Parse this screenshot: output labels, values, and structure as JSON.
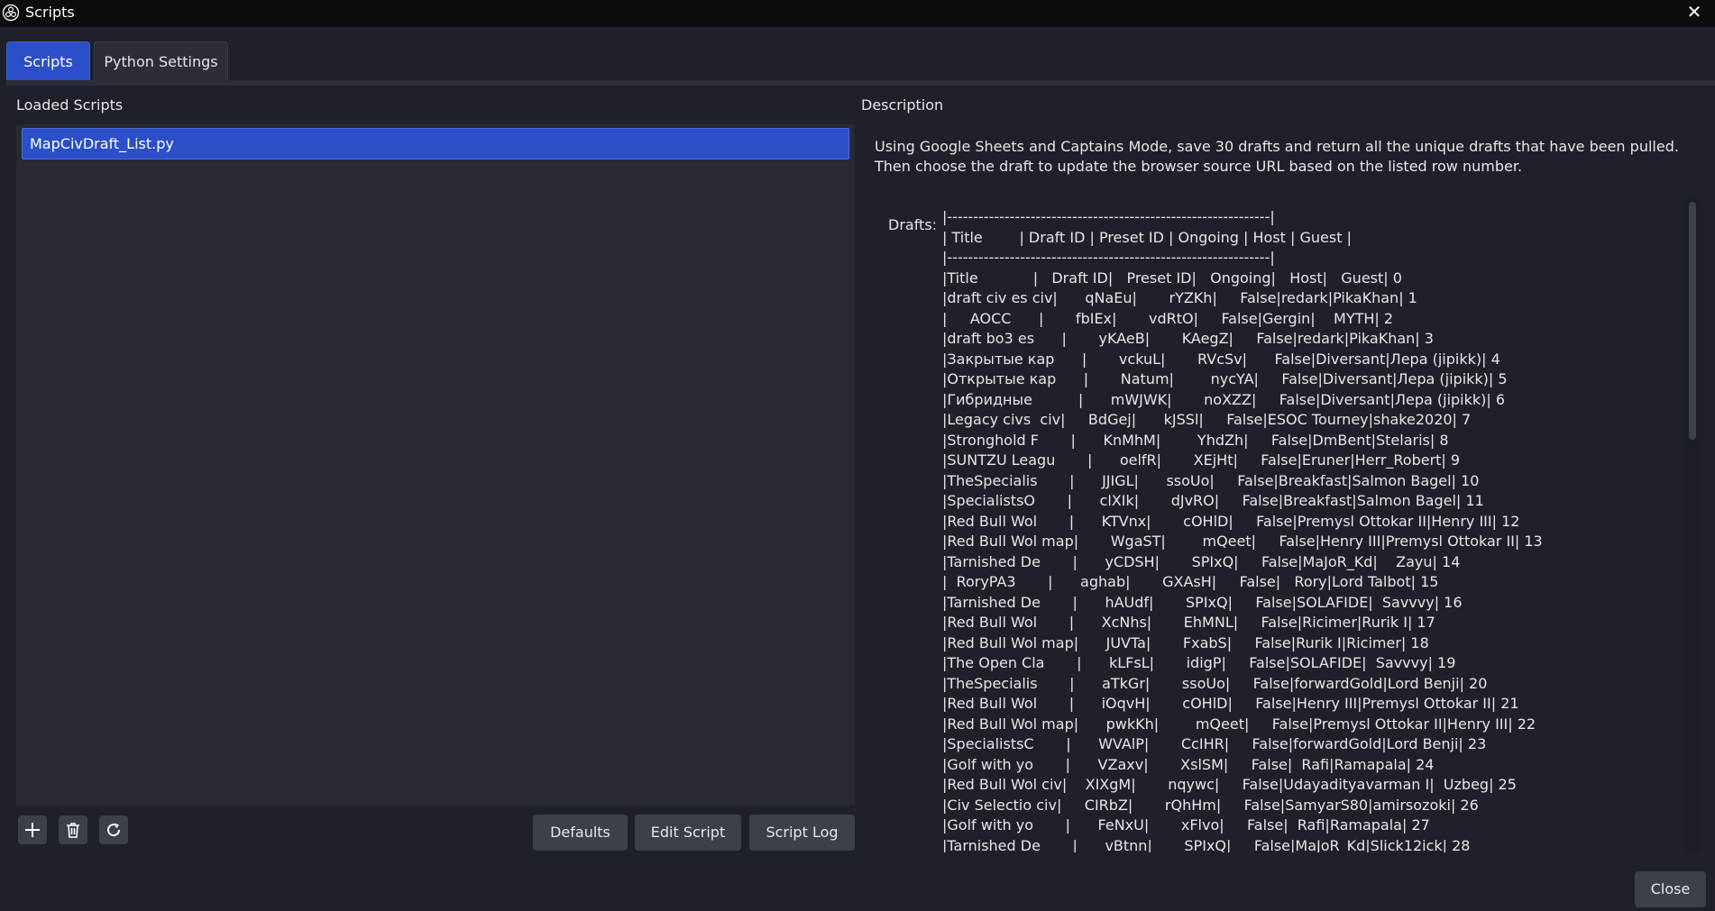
{
  "window": {
    "title": "Scripts",
    "close_glyph": "✕"
  },
  "tabs": [
    {
      "label": "Scripts",
      "active": true
    },
    {
      "label": "Python Settings",
      "active": false
    }
  ],
  "left": {
    "heading": "Loaded Scripts",
    "scripts": [
      "MapCivDraft_List.py"
    ],
    "icons": [
      "add-icon",
      "trash-icon",
      "reload-icon"
    ],
    "buttons": {
      "defaults": "Defaults",
      "edit": "Edit Script",
      "log": "Script Log"
    }
  },
  "right": {
    "heading": "Description",
    "description": "Using Google Sheets and Captains Mode, save 30 drafts and return all the unique drafts that have been pulled. Then choose the draft to update the browser source URL based on the listed row number.",
    "drafts_label": "Drafts:",
    "drafts_lines": [
      "|--------------------------------------------------------------|",
      "| Title        | Draft ID | Preset ID | Ongoing | Host | Guest |",
      "|--------------------------------------------------------------|",
      "|Title            |   Draft ID|   Preset ID|   Ongoing|   Host|   Guest| 0",
      "|draft civ es civ|      qNaEu|       rYZKh|     False|redark|PikaKhan| 1",
      "|     AOCC      |       fbIEx|       vdRtO|     False|Gergin|    MYTH| 2",
      "|draft bo3 es      |       yKAeB|       KAegZ|     False|redark|PikaKhan| 3",
      "|Закрытые кар      |       vckuL|       RVcSv|      False|Diversant|Лера (jipikk)| 4",
      "|Открытые кар      |       Natum|        nycYA|     False|Diversant|Лера (jipikk)| 5",
      "|Гибридные          |      mWJWK|       noXZZ|     False|Diversant|Лера (jipikk)| 6",
      "|Legacy civs  civ|     BdGej|      kJSSl|     False|ESOC Tourney|shake2020| 7",
      "|Stronghold F       |      KnMhM|        YhdZh|     False|DmBent|Stelaris| 8",
      "|SUNTZU Leagu       |      oelfR|       XEjHt|     False|Eruner|Herr_Robert| 9",
      "|TheSpecialis       |      JJIGL|      ssoUo|     False|Breakfast|Salmon Bagel| 10",
      "|SpecialistsO       |      clXIk|       dJvRO|     False|Breakfast|Salmon Bagel| 11",
      "|Red Bull Wol       |      KTVnx|       cOHlD|     False|Premysl Ottokar II|Henry III| 12",
      "|Red Bull Wol map|       WgaST|        mQeet|     False|Henry III|Premysl Ottokar II| 13",
      "|Tarnished De       |      yCDSH|       SPIxQ|     False|MaJoR_Kd|    Zayu| 14",
      "|  RoryPA3       |      aghab|       GXAsH|     False|   Rory|Lord Talbot| 15",
      "|Tarnished De       |      hAUdf|       SPIxQ|     False|SOLAFIDE|  Savvvy| 16",
      "|Red Bull Wol       |      XcNhs|       EhMNL|     False|Ricimer|Rurik I| 17",
      "|Red Bull Wol map|      JUVTa|       FxabS|     False|Rurik I|Ricimer| 18",
      "|The Open Cla       |      kLFsL|       idigP|     False|SOLAFIDE|  Savvvy| 19",
      "|TheSpecialis       |      aTkGr|       ssoUo|     False|forwardGold|Lord Benji| 20",
      "|Red Bull Wol       |      iOqvH|       cOHlD|     False|Henry III|Premysl Ottokar II| 21",
      "|Red Bull Wol map|      pwkKh|        mQeet|     False|Premysl Ottokar II|Henry III| 22",
      "|SpecialistsC       |      WVAlP|       CcIHR|     False|forwardGold|Lord Benji| 23",
      "|Golf with yo       |      VZaxv|       XslSM|     False|  Rafi|Ramapala| 24",
      "|Red Bull Wol civ|    XIXgM|       nqywc|     False|Udayadityavarman I|  Uzbeg| 25",
      "|Civ Selectio civ|     CIRbZ|       rQhHm|     False|SamyarS80|amirsozoki| 26",
      "|Golf with yo       |      FeNxU|       xFlvo|     False|  Rafi|Ramapala| 27",
      "|Tarnished De       |      vBtnn|       SPIxQ|     False|MaJoR_Kd|Slick12ick| 28"
    ]
  },
  "footer": {
    "close_label": "Close"
  }
}
